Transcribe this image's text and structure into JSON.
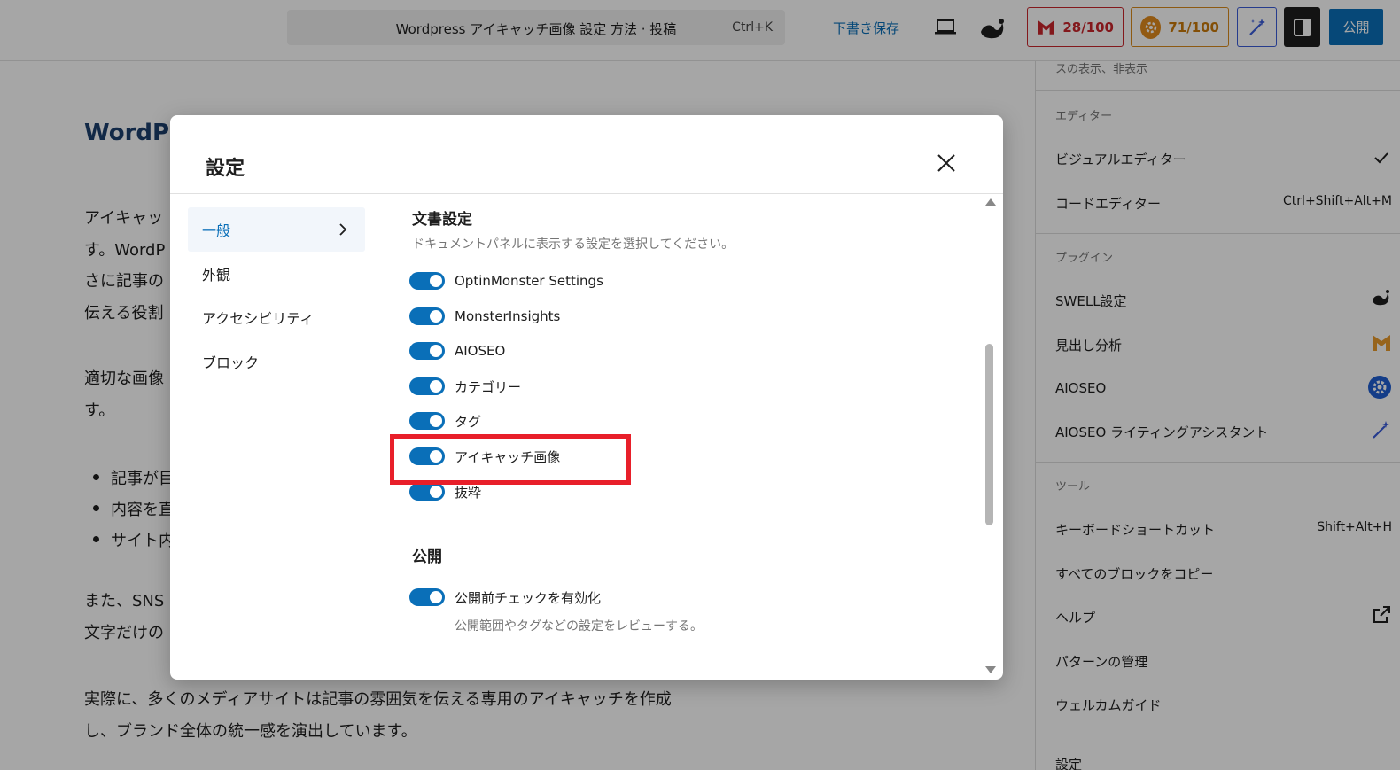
{
  "topbar": {
    "doc_title": "Wordpress アイキャッチ画像 設定 方法 · 投稿",
    "shortcut": "Ctrl+K",
    "draft_save": "下書き保存",
    "headline_score": "28/100",
    "seo_score": "71/100",
    "publish": "公開"
  },
  "editor": {
    "heading": "WordPr",
    "para1": [
      "アイキャッ",
      "す。WordP",
      "さに記事の",
      "伝える役割"
    ],
    "para2": [
      "適切な画像",
      "す。"
    ],
    "bullets": [
      "記事が目",
      "内容を直",
      "サイト内"
    ],
    "para3": [
      "また、SNS",
      "文字だけの"
    ],
    "para4": [
      "実際に、多くのメディアサイトは記事の雰囲気を伝える専用のアイキャッチを作成",
      "し、ブランド全体の統一感を演出しています。"
    ]
  },
  "menu": {
    "top_partial": "スの表示、非表示",
    "editor_group": "エディター",
    "visual_editor": "ビジュアルエディター",
    "code_editor": "コードエディター",
    "code_editor_shortcut": "Ctrl+Shift+Alt+M",
    "plugins_group": "プラグイン",
    "swell_settings": "SWELL設定",
    "heading_analysis": "見出し分析",
    "aioseo": "AIOSEO",
    "aioseo_assistant": "AIOSEO ライティングアシスタント",
    "tools_group": "ツール",
    "keyboard_shortcuts": "キーボードショートカット",
    "keyboard_shortcuts_key": "Shift+Alt+H",
    "copy_all_blocks": "すべてのブロックをコピー",
    "help": "ヘルプ",
    "manage_patterns": "パターンの管理",
    "welcome_guide": "ウェルカムガイド",
    "settings_partial": "設定"
  },
  "modal": {
    "title": "設定",
    "nav": [
      "一般",
      "外観",
      "アクセシビリティ",
      "ブロック"
    ],
    "doc_section_title": "文書設定",
    "doc_section_desc": "ドキュメントパネルに表示する設定を選択してください。",
    "toggles": [
      {
        "label": "OptinMonster Settings",
        "on": true
      },
      {
        "label": "MonsterInsights",
        "on": true
      },
      {
        "label": "AIOSEO",
        "on": true
      },
      {
        "label": "カテゴリー",
        "on": true
      },
      {
        "label": "タグ",
        "on": true
      },
      {
        "label": "アイキャッチ画像",
        "on": true
      },
      {
        "label": "抜粋",
        "on": true
      }
    ],
    "publish_section_title": "公開",
    "prepublish_label": "公開前チェックを有効化",
    "prepublish_help": "公開範囲やタグなどの設定をレビューする。"
  },
  "colors": {
    "accent": "#0a6fb8",
    "highlight": "#e81f2a",
    "headline_score": "#c9252c",
    "seo_score": "#d98a1c"
  }
}
